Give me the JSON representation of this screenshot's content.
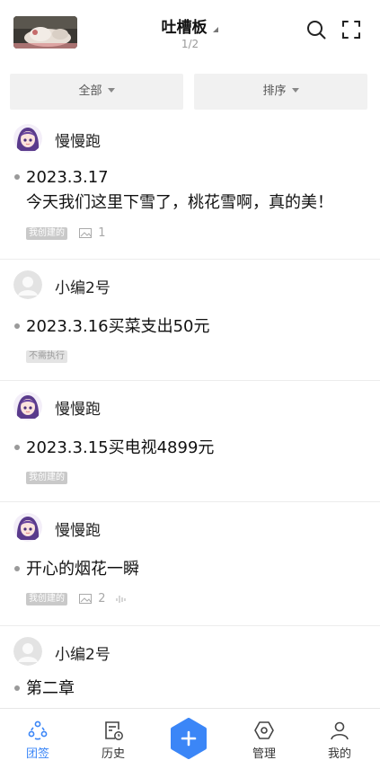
{
  "header": {
    "title": "吐槽板",
    "page_indicator": "1/2",
    "icons": [
      "search-icon",
      "fullscreen-icon",
      "caret-icon"
    ]
  },
  "filters": {
    "all_label": "全部",
    "sort_label": "排序"
  },
  "posts": [
    {
      "author": "慢慢跑",
      "avatar": "anime-girl-avatar",
      "lines": [
        "2023.3.17",
        "今天我们这里下雪了，桃花雪啊，真的美！"
      ],
      "tag": "我创建的",
      "image_count": "1",
      "has_audio": false
    },
    {
      "author": "小编2号",
      "avatar": "default-user-avatar",
      "lines": [
        "2023.3.16买菜支出50元"
      ],
      "tag": "不需执行",
      "image_count": null,
      "has_audio": false
    },
    {
      "author": "慢慢跑",
      "avatar": "anime-girl-avatar",
      "lines": [
        "2023.3.15买电视4899元"
      ],
      "tag": "我创建的",
      "image_count": null,
      "has_audio": false
    },
    {
      "author": "慢慢跑",
      "avatar": "anime-girl-avatar",
      "lines": [
        "开心的烟花一瞬"
      ],
      "tag": "我创建的",
      "image_count": "2",
      "has_audio": true
    },
    {
      "author": "小编2号",
      "avatar": "default-user-avatar",
      "lines": [
        "第二章"
      ],
      "tag": null,
      "image_count": null,
      "has_audio": false
    }
  ],
  "tabbar": {
    "tabs": [
      {
        "label": "团签",
        "icon": "team-icon",
        "active": true
      },
      {
        "label": "历史",
        "icon": "history-icon",
        "active": false
      },
      {
        "label": "",
        "icon": "add-icon",
        "active": false
      },
      {
        "label": "管理",
        "icon": "manage-icon",
        "active": false
      },
      {
        "label": "我的",
        "icon": "profile-icon",
        "active": false
      }
    ]
  },
  "colors": {
    "accent": "#3b86f7",
    "tag_bg": "#c9c9c9",
    "filter_bg": "#f1f1f1"
  }
}
